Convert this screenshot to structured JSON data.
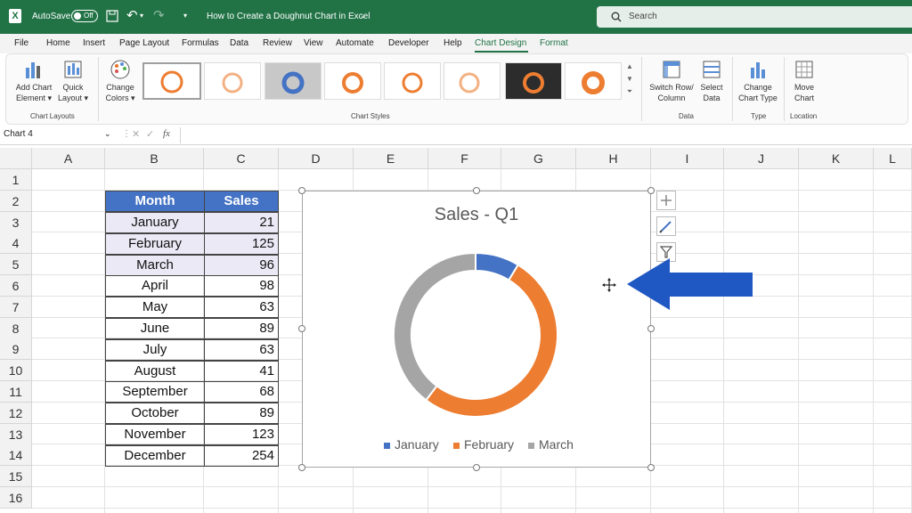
{
  "titlebar": {
    "autosave_label": "AutoSave",
    "autosave_state": "Off",
    "doc_title": "How to Create a Doughnut Chart in Excel",
    "search_placeholder": "Search"
  },
  "tabs": [
    "File",
    "Home",
    "Insert",
    "Page Layout",
    "Formulas",
    "Data",
    "Review",
    "View",
    "Automate",
    "Developer",
    "Help",
    "Chart Design",
    "Format"
  ],
  "active_tab": "Chart Design",
  "ribbon": {
    "add_chart_element": [
      "Add Chart",
      "Element"
    ],
    "quick_layout": [
      "Quick",
      "Layout"
    ],
    "change_colors": [
      "Change",
      "Colors"
    ],
    "switch_row_column": [
      "Switch Row/",
      "Column"
    ],
    "select_data": [
      "Select",
      "Data"
    ],
    "change_chart_type": [
      "Change",
      "Chart Type"
    ],
    "move_chart": [
      "Move",
      "Chart"
    ],
    "groups": {
      "chart_layouts": "Chart Layouts",
      "chart_styles": "Chart Styles",
      "data": "Data",
      "type": "Type",
      "location": "Location"
    }
  },
  "formula_bar": {
    "name_box": "Chart 4",
    "fx": "fx"
  },
  "columns": [
    "A",
    "B",
    "C",
    "D",
    "E",
    "F",
    "G",
    "H",
    "I",
    "J",
    "K",
    "L"
  ],
  "rows": [
    "1",
    "2",
    "3",
    "4",
    "5",
    "6",
    "7",
    "8",
    "9",
    "10",
    "11",
    "12",
    "13",
    "14",
    "15",
    "16"
  ],
  "table": {
    "headers": [
      "Month",
      "Sales"
    ],
    "rows": [
      [
        "January",
        "21"
      ],
      [
        "February",
        "125"
      ],
      [
        "March",
        "96"
      ],
      [
        "April",
        "98"
      ],
      [
        "May",
        "63"
      ],
      [
        "June",
        "89"
      ],
      [
        "July",
        "63"
      ],
      [
        "August",
        "41"
      ],
      [
        "September",
        "68"
      ],
      [
        "October",
        "89"
      ],
      [
        "November",
        "123"
      ],
      [
        "December",
        "254"
      ]
    ]
  },
  "chart_data": {
    "type": "pie",
    "subtype": "doughnut",
    "title": "Sales - Q1",
    "categories": [
      "January",
      "February",
      "March"
    ],
    "values": [
      21,
      125,
      96
    ],
    "colors": [
      "#4472c4",
      "#ed7d31",
      "#a5a5a5"
    ],
    "legend_position": "bottom"
  },
  "colors": {
    "excel_green": "#217346",
    "arrow_blue": "#1f57c3",
    "header_blue": "#4472c4"
  }
}
